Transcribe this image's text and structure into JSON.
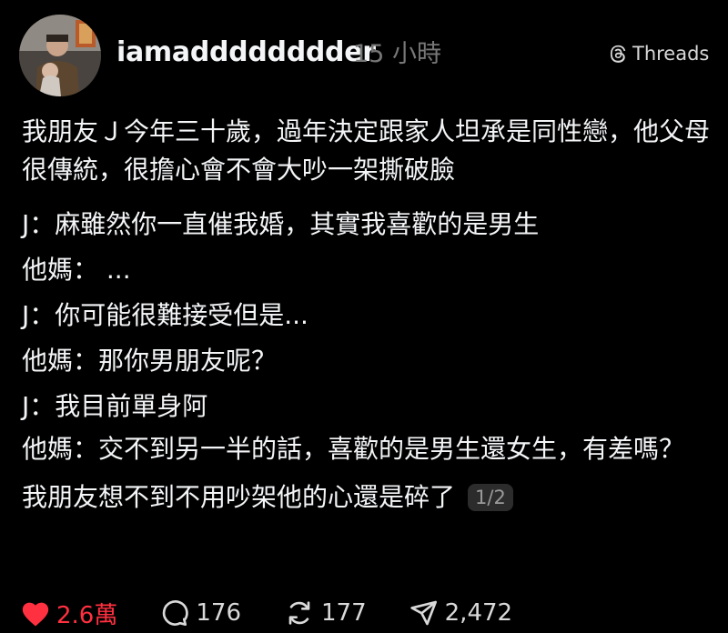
{
  "post": {
    "username": "iamadddddddder",
    "timestamp": "15 小時",
    "platform": "Threads",
    "intro": "我朋友Ｊ今年三十歲，過年決定跟家人坦承是同性戀，他父母很傳統，很擔心會不會大吵一架撕破臉",
    "dialogue": [
      "J：麻雖然你一直催我婚，其實我喜歡的是男生",
      "他媽： ...",
      "J：你可能很難接受但是...",
      "他媽：那你男朋友呢？",
      "J：我目前單身阿",
      "他媽：交不到另一半的話，喜歡的是男生還女生，有差嗎？"
    ],
    "ending": "我朋友想不到不用吵架他的心還是碎了",
    "page_indicator": "1/2"
  },
  "actions": {
    "likes": "2.6萬",
    "comments": "176",
    "reposts": "177",
    "shares": "2,472"
  },
  "colors": {
    "background": "#000000",
    "text": "#f3f5f7",
    "muted": "#777777",
    "like": "#ff3040"
  },
  "icons": {
    "like": "heart-icon",
    "comment": "comment-bubble-icon",
    "repost": "repost-icon",
    "share": "send-icon",
    "platform": "threads-logo-icon"
  }
}
